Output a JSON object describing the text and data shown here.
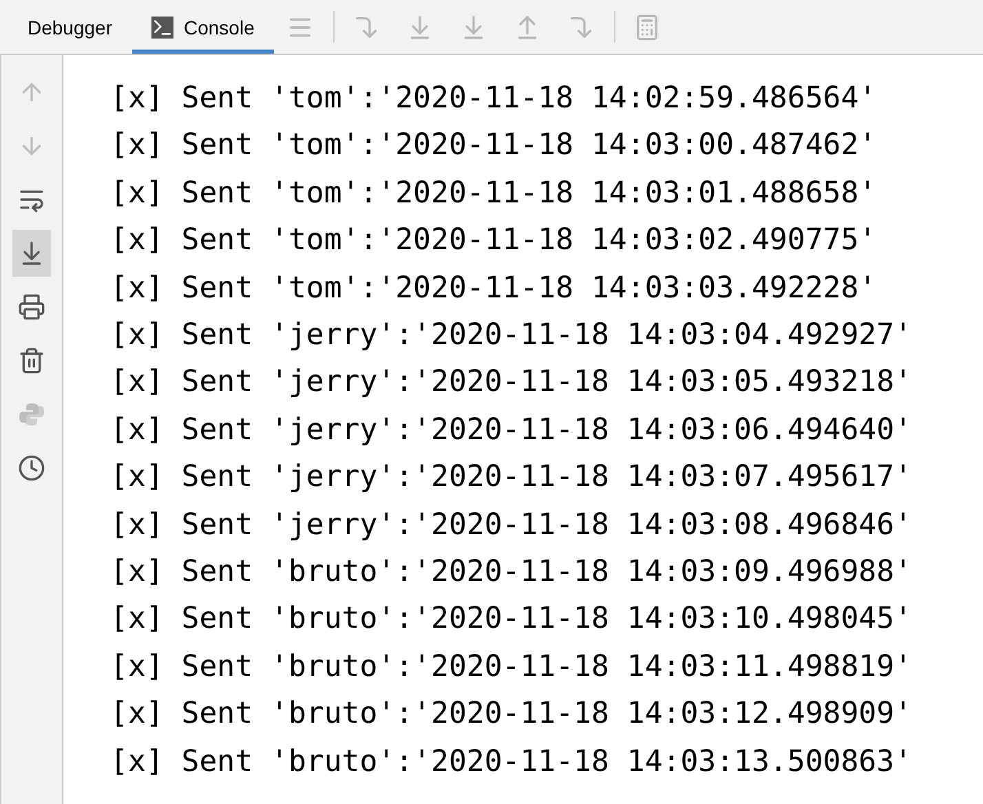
{
  "tabs": [
    {
      "label": "Debugger",
      "selected": false,
      "kind": "plain"
    },
    {
      "label": "Console",
      "selected": true,
      "kind": "console"
    }
  ],
  "toolbar_buttons": [
    {
      "kind": "menu",
      "disabled": true
    },
    {
      "kind": "step-over",
      "disabled": true
    },
    {
      "kind": "step-into",
      "disabled": true
    },
    {
      "kind": "step-into-mine",
      "disabled": true
    },
    {
      "kind": "step-out",
      "disabled": true
    },
    {
      "kind": "run-to-cursor",
      "disabled": true
    },
    {
      "kind": "evaluate",
      "disabled": true
    }
  ],
  "gutter_buttons": [
    {
      "kind": "up",
      "disabled": true,
      "selected": false
    },
    {
      "kind": "down",
      "disabled": true,
      "selected": false
    },
    {
      "kind": "wrap",
      "disabled": false,
      "selected": false
    },
    {
      "kind": "scroll-end",
      "disabled": false,
      "selected": true
    },
    {
      "kind": "print",
      "disabled": false,
      "selected": false
    },
    {
      "kind": "clear",
      "disabled": false,
      "selected": false
    },
    {
      "kind": "python",
      "disabled": true,
      "selected": false
    },
    {
      "kind": "history",
      "disabled": false,
      "selected": false
    }
  ],
  "console_lines": [
    "[x] Sent 'tom':'2020-11-18 14:02:59.486564'",
    "[x] Sent 'tom':'2020-11-18 14:03:00.487462'",
    "[x] Sent 'tom':'2020-11-18 14:03:01.488658'",
    "[x] Sent 'tom':'2020-11-18 14:03:02.490775'",
    "[x] Sent 'tom':'2020-11-18 14:03:03.492228'",
    "[x] Sent 'jerry':'2020-11-18 14:03:04.492927'",
    "[x] Sent 'jerry':'2020-11-18 14:03:05.493218'",
    "[x] Sent 'jerry':'2020-11-18 14:03:06.494640'",
    "[x] Sent 'jerry':'2020-11-18 14:03:07.495617'",
    "[x] Sent 'jerry':'2020-11-18 14:03:08.496846'",
    "[x] Sent 'bruto':'2020-11-18 14:03:09.496988'",
    "[x] Sent 'bruto':'2020-11-18 14:03:10.498045'",
    "[x] Sent 'bruto':'2020-11-18 14:03:11.498819'",
    "[x] Sent 'bruto':'2020-11-18 14:03:12.498909'",
    "[x] Sent 'bruto':'2020-11-18 14:03:13.500863'"
  ]
}
